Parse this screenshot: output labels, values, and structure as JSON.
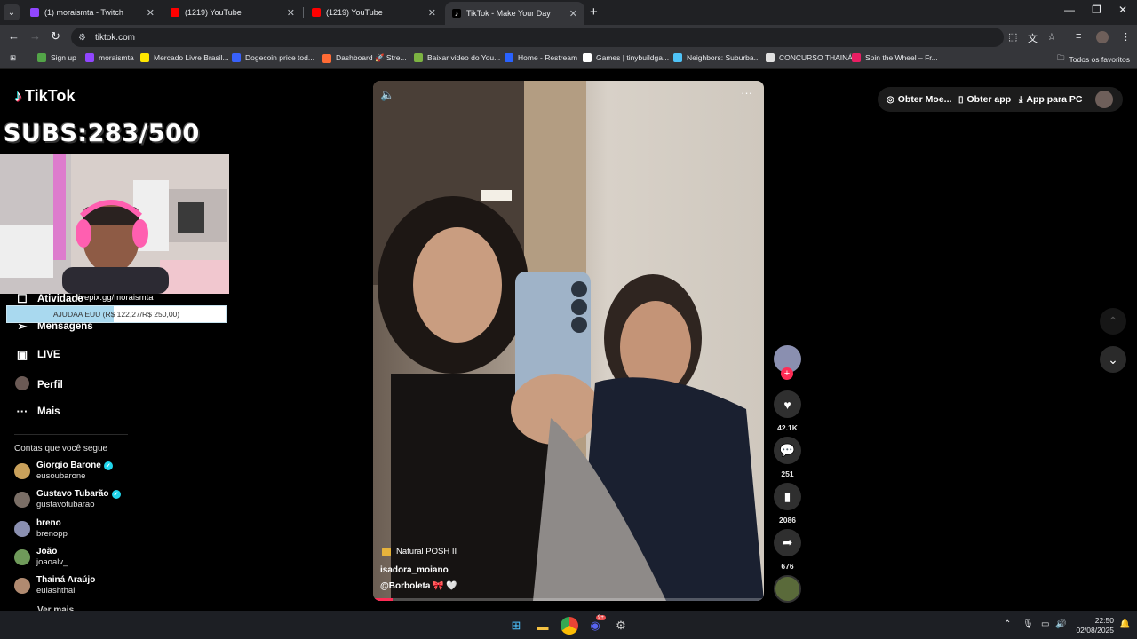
{
  "browser": {
    "tabs": [
      {
        "title": "(1) moraismta - Twitch",
        "favicon_color": "#9146ff",
        "active": false
      },
      {
        "title": "(1219) YouTube",
        "favicon_color": "#ff0000",
        "active": false
      },
      {
        "title": "(1219) YouTube",
        "favicon_color": "#ff0000",
        "active": false
      },
      {
        "title": "TikTok - Make Your Day",
        "favicon_color": "#ffffff",
        "active": true
      }
    ],
    "new_tab_icon": "plus-icon",
    "url": "tiktok.com",
    "bookmarks": [
      {
        "label": "Sign up",
        "color": "#53a548"
      },
      {
        "label": "moraismta",
        "color": "#9146ff"
      },
      {
        "label": "Mercado Livre Brasil...",
        "color": "#ffe600"
      },
      {
        "label": "Dogecoin price tod...",
        "color": "#3861fb"
      },
      {
        "label": "Dashboard 🚀 Stre...",
        "color": "#ff6b35"
      },
      {
        "label": "Baixar video do You...",
        "color": "#7cb342"
      },
      {
        "label": "Home - Restream",
        "color": "#2962ff"
      },
      {
        "label": "Games | tinybuildga...",
        "color": "#ffffff"
      },
      {
        "label": "Neighbors: Suburba...",
        "color": "#4fc3f7"
      },
      {
        "label": "CONCURSO THAINÁ",
        "color": "#e0e0e0"
      },
      {
        "label": "Spin the Wheel – Fr...",
        "color": "#e91e63"
      }
    ],
    "all_bookmarks": "Todos os favoritos"
  },
  "tiktok": {
    "logo": "TikTok",
    "nav": [
      {
        "label": "Atividade",
        "icon": "inbox-icon"
      },
      {
        "label": "Mensagens",
        "icon": "paper-plane-icon"
      },
      {
        "label": "LIVE",
        "icon": "live-icon"
      },
      {
        "label": "Perfil",
        "icon": "profile-avatar"
      },
      {
        "label": "Mais",
        "icon": "more-dots-icon"
      }
    ],
    "following_title": "Contas que você segue",
    "accounts": [
      {
        "name": "Giorgio Barone",
        "handle": "eusoubarone",
        "verified": true,
        "color": "#c9a15b"
      },
      {
        "name": "Gustavo Tubarão",
        "handle": "gustavotubarao",
        "verified": true,
        "color": "#7a6e66"
      },
      {
        "name": "breno",
        "handle": "brenopp",
        "verified": false,
        "color": "#8a8fb0"
      },
      {
        "name": "João",
        "handle": "joaoalv_",
        "verified": false,
        "color": "#6f9a5a"
      },
      {
        "name": "Thainá Araújo",
        "handle": "eulashthai",
        "verified": false,
        "color": "#b08a70"
      }
    ],
    "see_more": "Ver mais",
    "video": {
      "music": "Natural POSH II",
      "username": "isadora_moiano",
      "description": "@Borboleta 🎀 🤍",
      "progress_fraction": 0.05
    },
    "actions": {
      "likes": "42.1K",
      "comments": "251",
      "saves": "2086",
      "shares": "676"
    },
    "header": {
      "coins": "Obter Moe...",
      "get_app": "Obter app",
      "app_pc": "App para PC"
    }
  },
  "stream_overlay": {
    "subs": "SUBS:283/500",
    "livepix": "livepix.gg/moraismta",
    "donation_text": "AJUDAA EUU (R$ 122,27/R$ 250,00)",
    "donation_fraction": 0.489
  },
  "taskbar": {
    "time": "22:50",
    "date": "02/08/2025",
    "discord_badge": "9+"
  }
}
